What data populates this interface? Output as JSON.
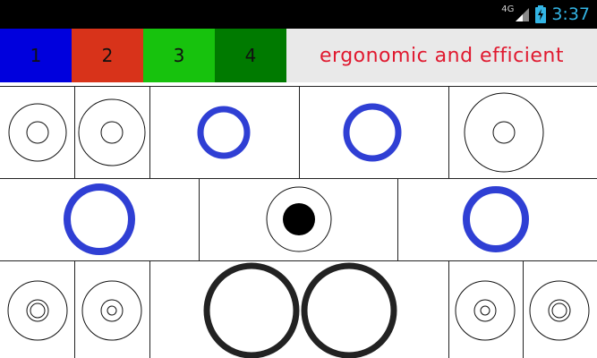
{
  "status_bar": {
    "network": "4G",
    "clock": "3:37"
  },
  "toolbar": {
    "tabs": [
      {
        "label": "1",
        "color": "#0000dd"
      },
      {
        "label": "2",
        "color": "#d8331a"
      },
      {
        "label": "3",
        "color": "#17c20d"
      },
      {
        "label": "4",
        "color": "#007a00"
      }
    ],
    "headline": "ergonomic and efficient",
    "headline_color": "#e0192f"
  },
  "colors": {
    "ring_blue": "#2f3fd4",
    "ring_dark": "#222222",
    "outline": "#111111"
  }
}
